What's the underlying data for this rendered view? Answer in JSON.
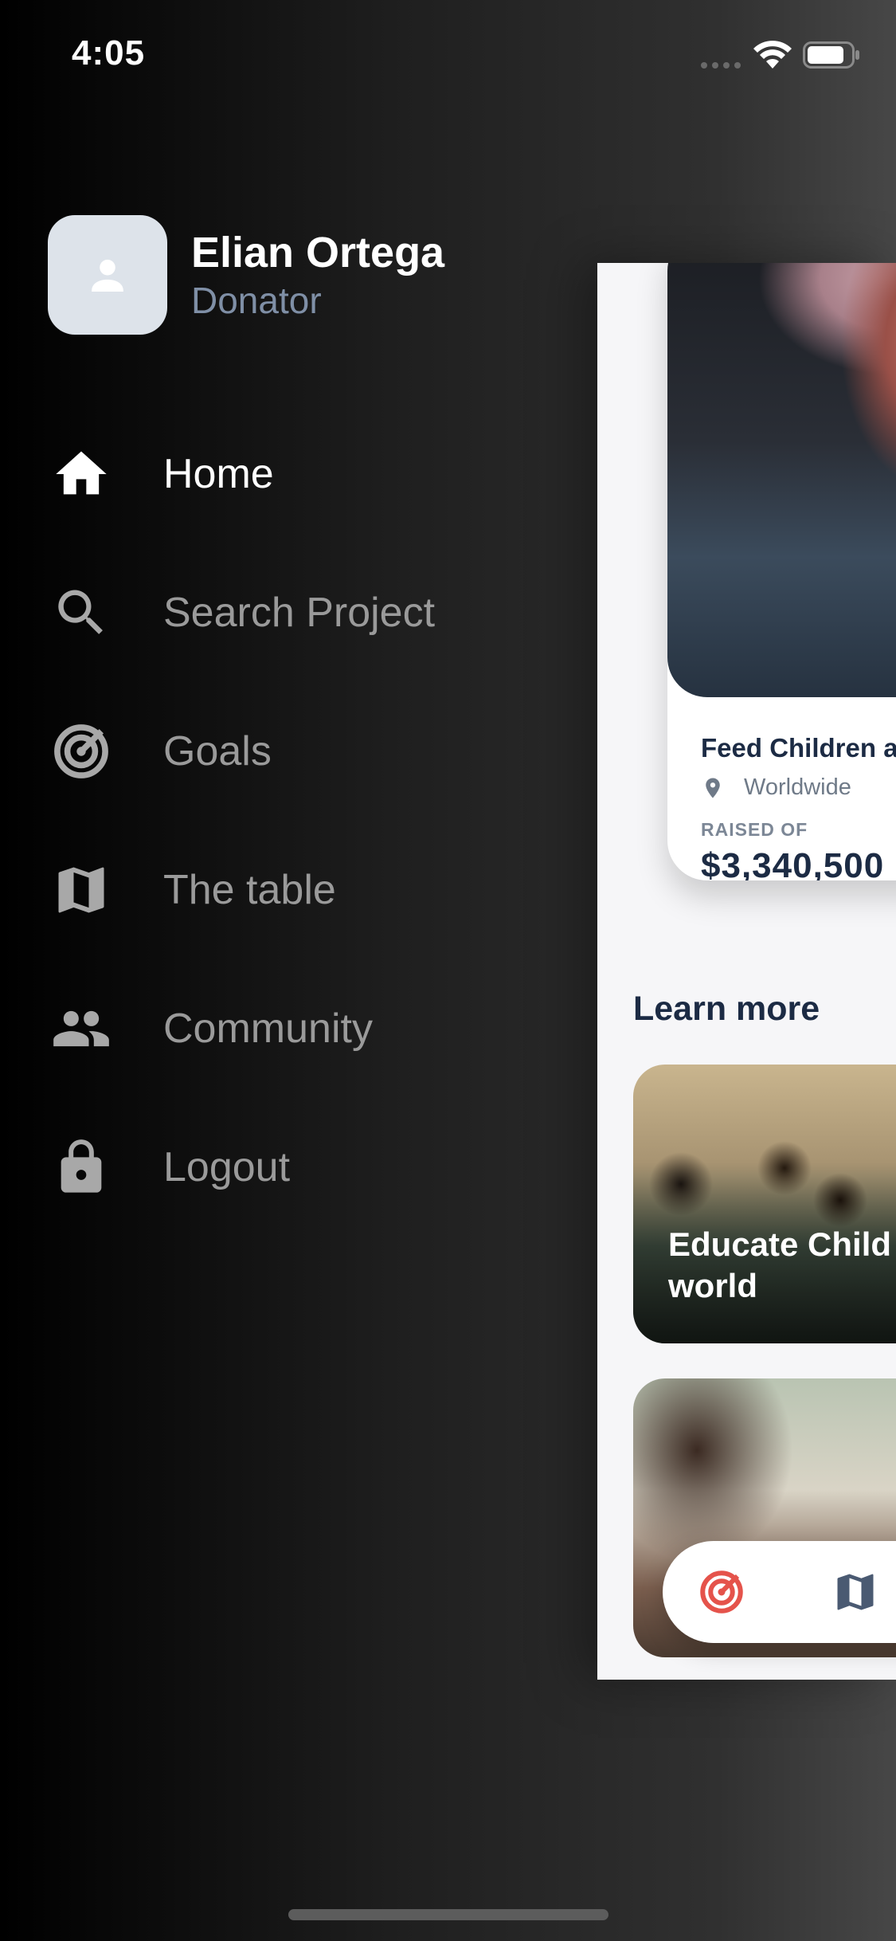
{
  "status_bar": {
    "time": "4:05"
  },
  "profile": {
    "name": "Elian Ortega",
    "role": "Donator"
  },
  "menu": {
    "items": [
      {
        "label": "Home",
        "icon": "home-icon",
        "active": true
      },
      {
        "label": "Search Project",
        "icon": "search-icon",
        "active": false
      },
      {
        "label": "Goals",
        "icon": "target-icon",
        "active": false
      },
      {
        "label": "The table",
        "icon": "map-icon",
        "active": false
      },
      {
        "label": "Community",
        "icon": "people-icon",
        "active": false
      },
      {
        "label": "Logout",
        "icon": "lock-icon",
        "active": false
      }
    ]
  },
  "content": {
    "project_card": {
      "title": "Feed Children a",
      "location": "Worldwide",
      "raised_label": "RAISED OF",
      "raised_value": "$3,340,500"
    },
    "learn_more": {
      "title": "Learn more",
      "cards": [
        {
          "title_line1": "Educate Child",
          "title_line2": "world"
        },
        {
          "title_line1": ""
        }
      ]
    },
    "floating_nav": {
      "icons": [
        "target-icon",
        "map-icon"
      ]
    }
  },
  "colors": {
    "accent_red": "#e5534b",
    "navy_text": "#1c2b44",
    "muted_blue": "#7f8fa6",
    "menu_inactive": "#9a9a9a"
  }
}
